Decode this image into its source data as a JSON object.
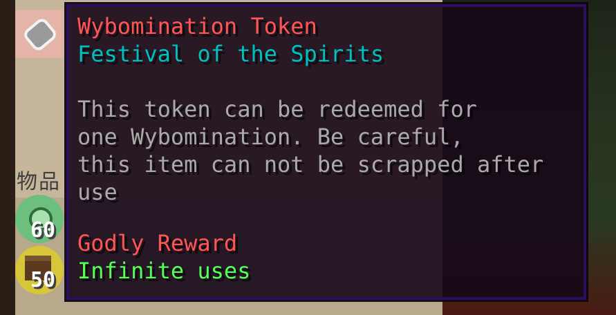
{
  "tooltip": {
    "title": "Wybomination Token",
    "subtitle": "Festival of the Spirits",
    "description": [
      "This token can be redeemed for",
      "one Wybomination. Be careful,",
      "this item can not be scrapped after",
      "use"
    ],
    "rarity": "Godly Reward",
    "uses": "Infinite uses",
    "colors": {
      "title": "#ff5555",
      "subtitle": "#00bfbf",
      "description": "#aaaaaa",
      "rarity": "#ff5555",
      "uses": "#55ff55",
      "border": "#2a0f5c"
    }
  },
  "inventory": {
    "category_label": "物品",
    "slots": [
      {
        "icon": "paperclip-token-icon",
        "count": ""
      },
      {
        "icon": "green-gem-icon",
        "count": "60"
      },
      {
        "icon": "wooden-chest-icon",
        "count": "50"
      }
    ]
  }
}
